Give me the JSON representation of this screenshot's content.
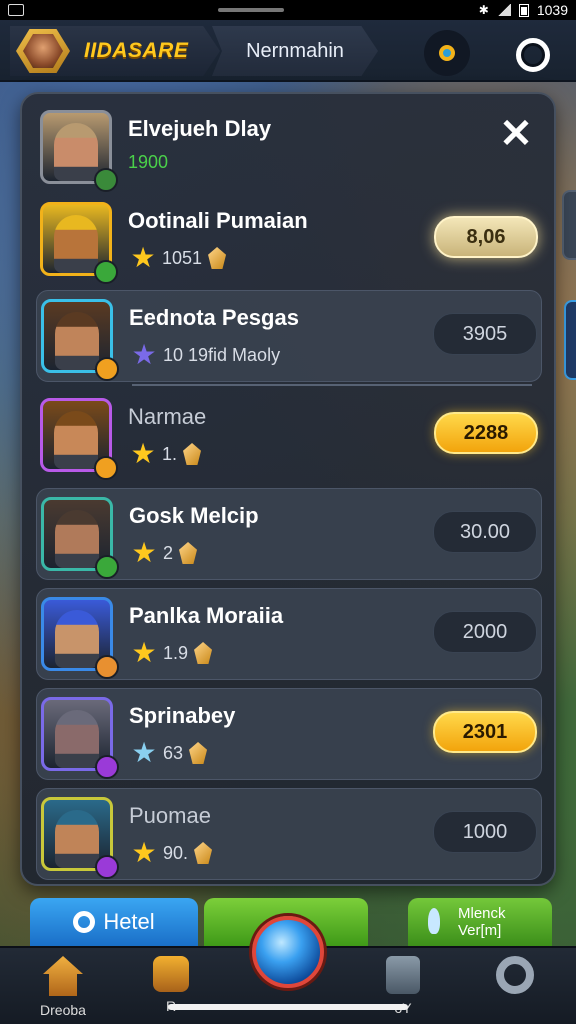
{
  "status_bar": {
    "time": "1039"
  },
  "header": {
    "player_name": "IIDASARE",
    "mode_tab": "Nernmahin"
  },
  "leaderboard": {
    "rows": [
      {
        "name": "Elvejueh Dlay",
        "stat": "1900",
        "score": "",
        "score_style": "none",
        "ring": "#8a8f99",
        "dot": "#3a8a3a",
        "hair": "#b89a70",
        "skin": "#c98c6a"
      },
      {
        "name": "Ootinali Pumaian",
        "stat": "1051",
        "score": "8,06",
        "score_style": "pale",
        "ring": "#f2b21a",
        "dot": "#3aa83a",
        "hair": "#e8b820",
        "skin": "#b8743a"
      },
      {
        "name": "Eednota Pesgas",
        "stat": "10 19fid Maoly",
        "score": "3905",
        "score_style": "dark",
        "ring": "#3ac0e8",
        "dot": "#f0a020",
        "hair": "#5a3a22",
        "skin": "#c0845a"
      },
      {
        "name": "Narmae",
        "stat": "1.",
        "score": "2288",
        "score_style": "gold",
        "ring": "#b85ae8",
        "dot": "#f0a020",
        "hair": "#7a4a1a",
        "skin": "#c88858"
      },
      {
        "name": "Gosk Melcip",
        "stat": "2",
        "score": "30.00",
        "score_style": "dark",
        "ring": "#3ab8a8",
        "dot": "#3aa83a",
        "hair": "#4a3a30",
        "skin": "#b07a5a"
      },
      {
        "name": "Panlka Moraiia",
        "stat": "1.9",
        "score": "2000",
        "score_style": "dark",
        "ring": "#3a8ae8",
        "dot": "#e89030",
        "hair": "#3a5ad8",
        "skin": "#c8946a"
      },
      {
        "name": "Sprinabey",
        "stat": "63",
        "score": "2301",
        "score_style": "gold",
        "ring": "#7a6ae8",
        "dot": "#9a3ad8",
        "hair": "#6a6a7a",
        "skin": "#8a6a6a"
      },
      {
        "name": "Puomae",
        "stat": "90.",
        "score": "1000",
        "score_style": "dark",
        "ring": "#c8c83a",
        "dot": "#9a3ad8",
        "hair": "#2a6a8a",
        "skin": "#c08458"
      }
    ]
  },
  "actions": {
    "left": "Hetel",
    "middle": "",
    "right_line1": "Mlenck",
    "right_line2": "Ver[m]"
  },
  "nav": {
    "home": "Dreoba",
    "chest": "R",
    "card": "oY",
    "settings": ""
  }
}
